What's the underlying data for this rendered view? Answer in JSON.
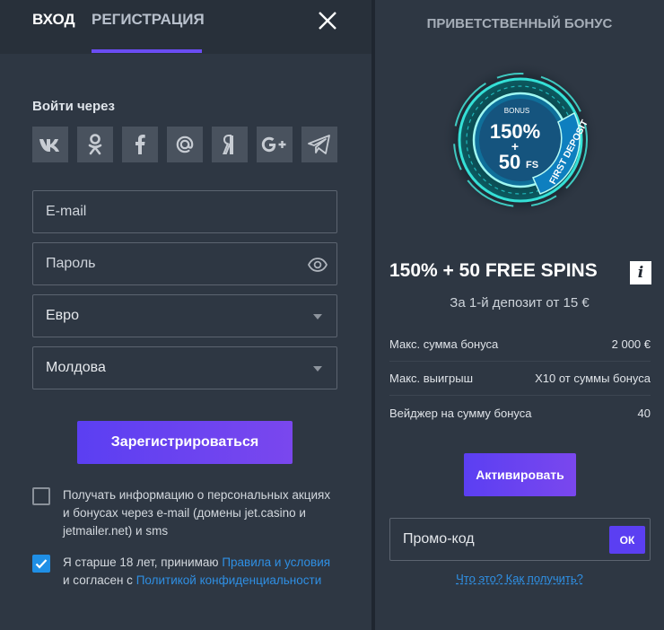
{
  "tabs": {
    "login": "ВХОД",
    "register": "РЕГИСТРАЦИЯ"
  },
  "social": {
    "title": "Войти через",
    "items": [
      "vk",
      "odnoklassniki",
      "facebook",
      "mail-ru",
      "yandex",
      "google-plus",
      "telegram"
    ]
  },
  "form": {
    "email_placeholder": "E-mail",
    "password_placeholder": "Пароль",
    "currency": "Евро",
    "country": "Молдова",
    "register_button": "Зарегистрироваться"
  },
  "consent": {
    "news_text": "Получать информацию о персональных акциях и бонусах через e-mail (домены jet.casino и jetmailer.net) и sms",
    "news_checked": false,
    "age_prefix": "Я старше 18 лет, принимаю ",
    "age_link_terms": "Правила и условия",
    "age_middle": " и согласен с ",
    "age_link_privacy": "Политикой конфиденциальности",
    "age_checked": true
  },
  "bonus": {
    "title": "ПРИВЕТСТВЕННЫЙ БОНУС",
    "image_bonus_label": "BONUS",
    "image_percent": "150%",
    "image_plus": "+",
    "image_fs": "50",
    "image_fs_suffix": "FS",
    "image_ribbon": "FIRST DEPOSIT",
    "offer": "150% + 50 FREE SPINS",
    "info_icon": "i",
    "deposit": "За 1-й депозит от 15 €",
    "rows": [
      {
        "label": "Макс. сумма бонуса",
        "value": "2 000 €"
      },
      {
        "label": "Макс. выигрыш",
        "value": "X10 от суммы бонуса"
      },
      {
        "label": "Вейджер на сумму бонуса",
        "value": "40"
      }
    ],
    "activate_button": "Активировать",
    "promo_placeholder": "Промо-код",
    "ok_button": "ОК",
    "help_link": "Что это? Как получить?"
  },
  "colors": {
    "accent": "#5b3ff2",
    "link": "#2f8fe3",
    "panel": "#2e3743",
    "neon": "#35e0d6"
  }
}
